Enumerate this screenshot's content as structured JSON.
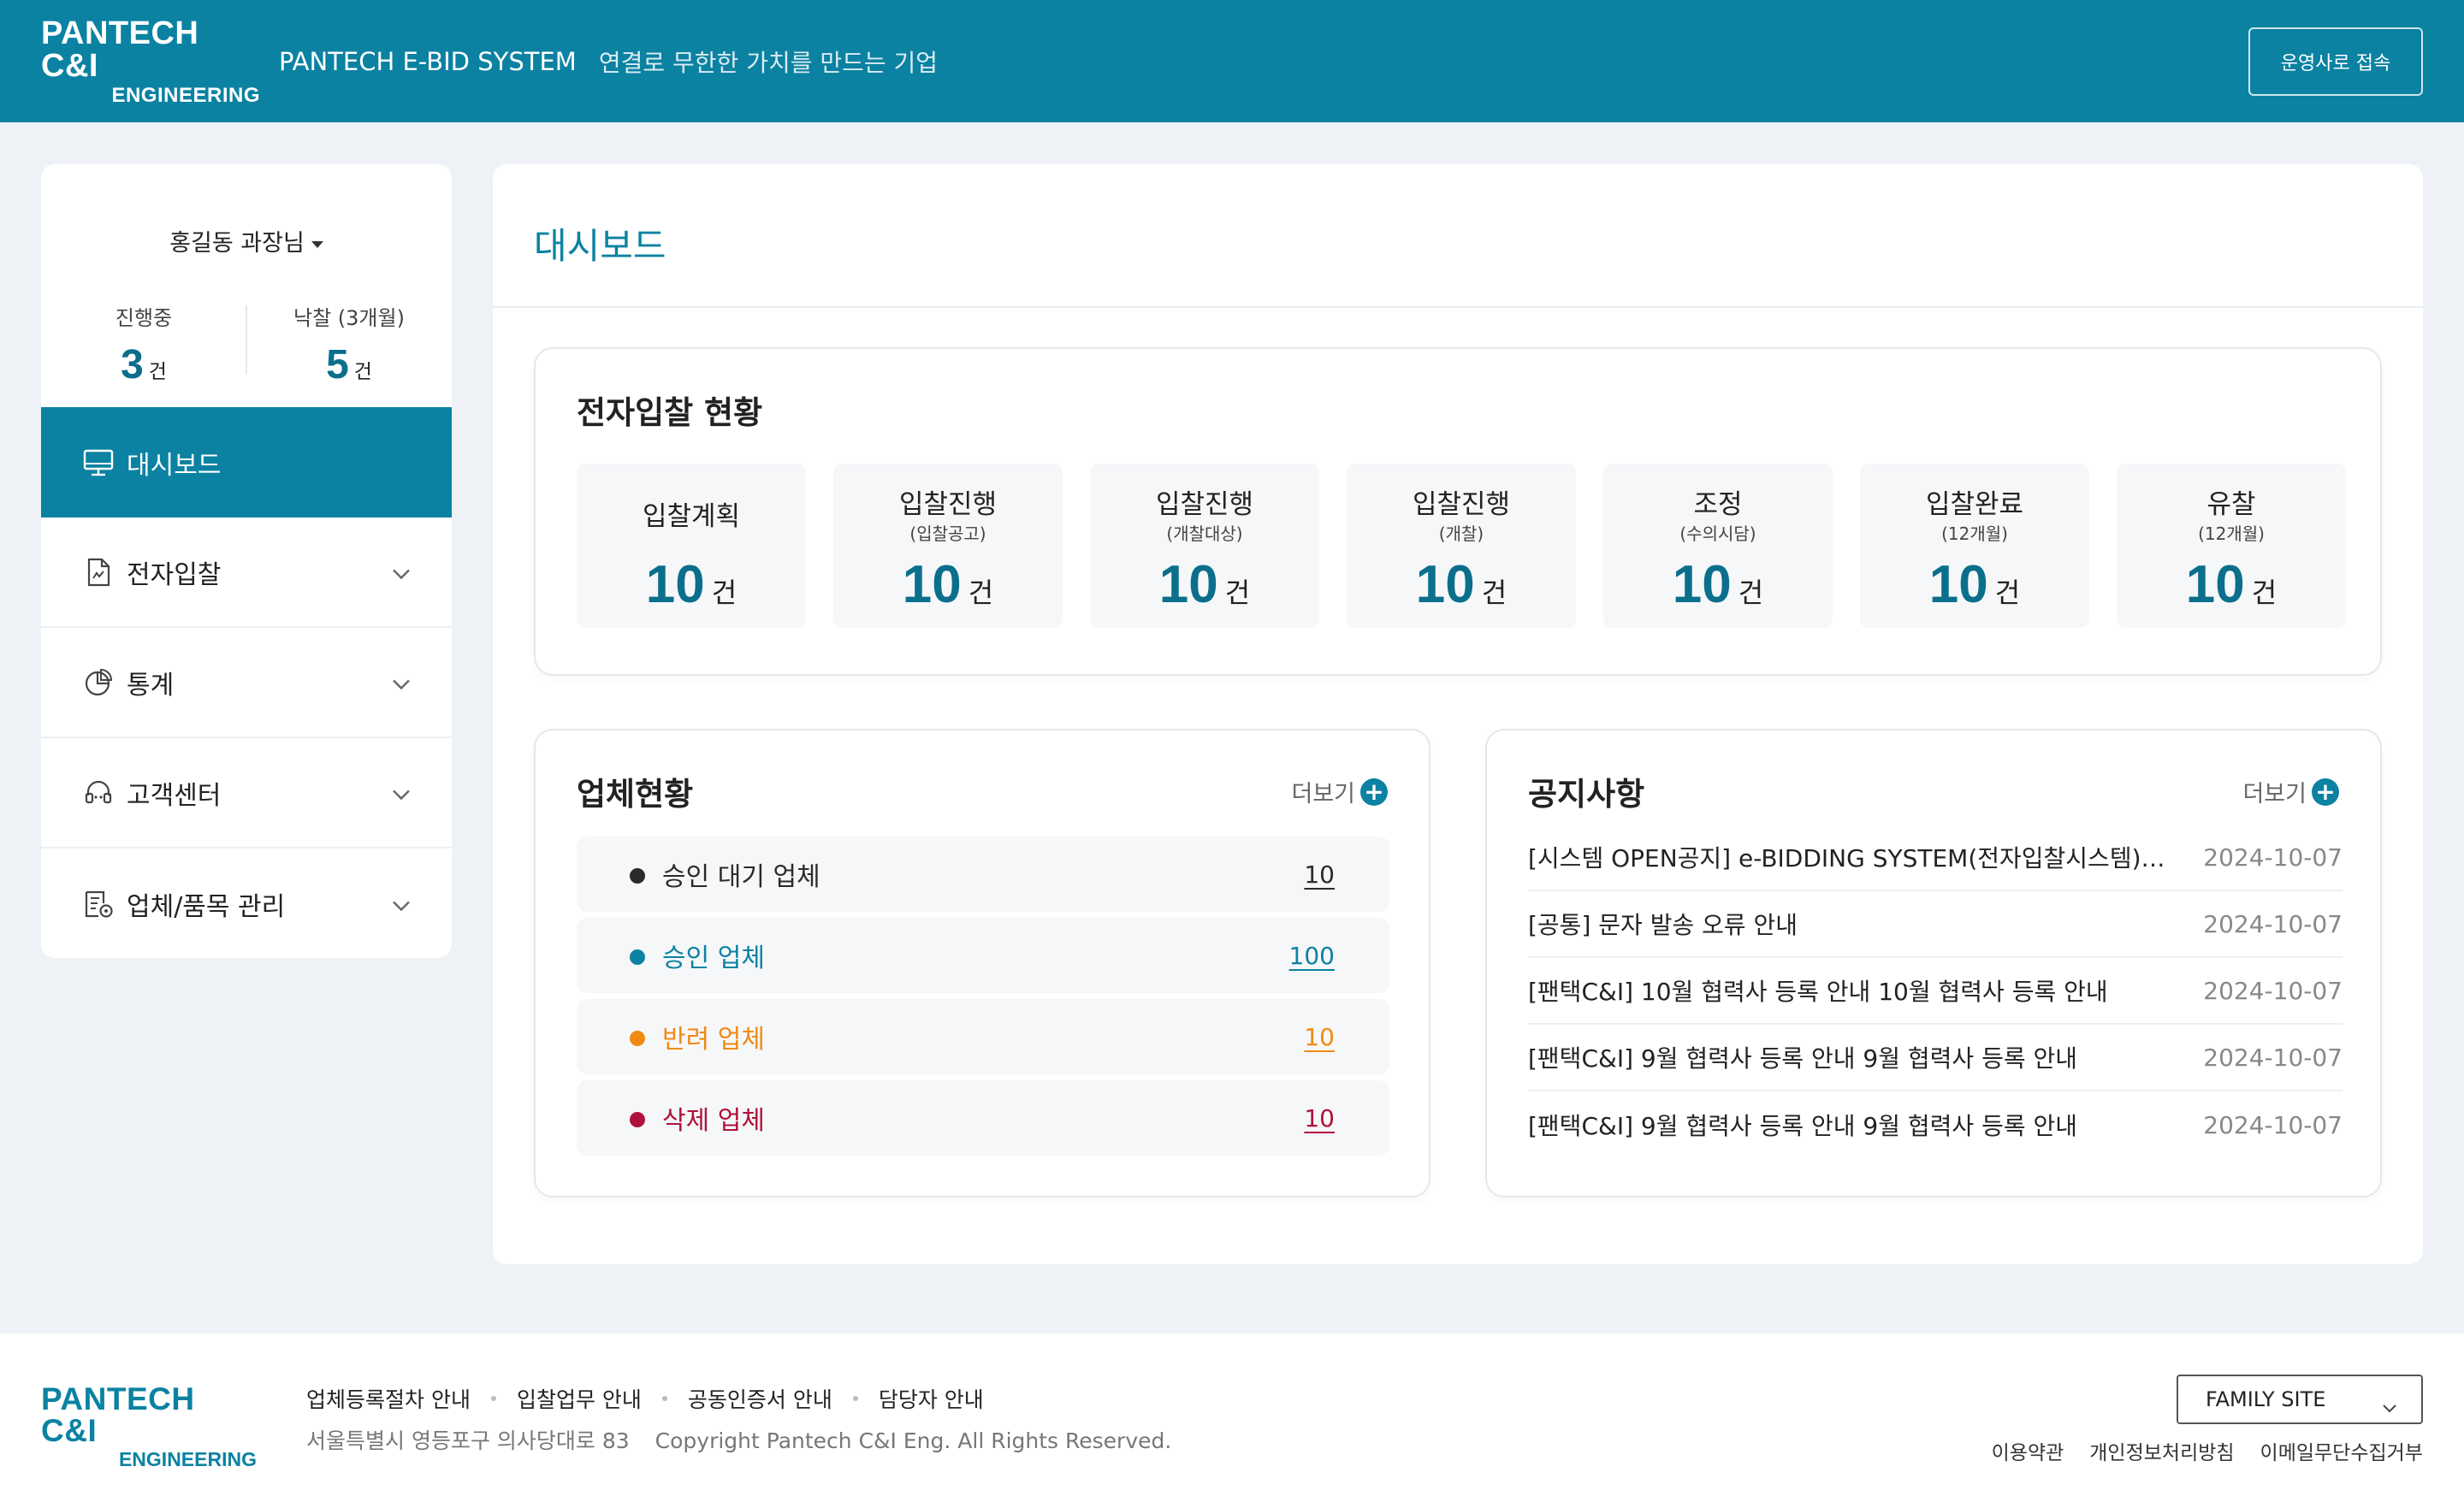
{
  "header": {
    "logo_line1": "PANTECH C&I",
    "logo_line2": "ENGINEERING",
    "system_name": "PANTECH E-BID SYSTEM",
    "slogan": "연결로 무한한 가치를 만드는 기업",
    "ops_button": "운영사로 접속"
  },
  "sidebar": {
    "user_name": "홍길동 과장님",
    "stats": [
      {
        "label": "진행중",
        "value": "3",
        "unit": "건"
      },
      {
        "label": "낙찰 (3개월)",
        "value": "5",
        "unit": "건"
      }
    ],
    "menu": [
      {
        "label": "대시보드",
        "icon": "monitor-icon",
        "active": true
      },
      {
        "label": "전자입찰",
        "icon": "document-icon"
      },
      {
        "label": "통계",
        "icon": "pie-chart-icon"
      },
      {
        "label": "고객센터",
        "icon": "headset-icon"
      },
      {
        "label": "업체/품목 관리",
        "icon": "list-settings-icon"
      }
    ]
  },
  "main": {
    "page_title": "대시보드",
    "bid_status": {
      "title": "전자입찰 현황",
      "tiles": [
        {
          "name": "입찰계획",
          "sub": "",
          "value": "10",
          "unit": "건"
        },
        {
          "name": "입찰진행",
          "sub": "(입찰공고)",
          "value": "10",
          "unit": "건"
        },
        {
          "name": "입찰진행",
          "sub": "(개찰대상)",
          "value": "10",
          "unit": "건"
        },
        {
          "name": "입찰진행",
          "sub": "(개찰)",
          "value": "10",
          "unit": "건"
        },
        {
          "name": "조정",
          "sub": "(수의시담)",
          "value": "10",
          "unit": "건"
        },
        {
          "name": "입찰완료",
          "sub": "(12개월)",
          "value": "10",
          "unit": "건"
        },
        {
          "name": "유찰",
          "sub": "(12개월)",
          "value": "10",
          "unit": "건"
        }
      ]
    },
    "company_status": {
      "title": "업체현황",
      "more": "더보기",
      "rows": [
        {
          "name": "승인 대기 업체",
          "count": "10",
          "color": "#2b2b2b"
        },
        {
          "name": "승인 업체",
          "count": "100",
          "color": "#0b82a2"
        },
        {
          "name": "반려 업체",
          "count": "10",
          "color": "#f08a12"
        },
        {
          "name": "삭제 업체",
          "count": "10",
          "color": "#b0123a"
        }
      ]
    },
    "notices": {
      "title": "공지사항",
      "more": "더보기",
      "rows": [
        {
          "title": "[시스템 OPEN공지] e-BIDDING SYSTEM(전자입찰시스템)이 ...",
          "date": "2024-10-07"
        },
        {
          "title": "[공통] 문자 발송 오류 안내",
          "date": "2024-10-07"
        },
        {
          "title": "[팬택C&I] 10월 협력사 등록 안내 10월 협력사 등록 안내",
          "date": "2024-10-07"
        },
        {
          "title": "[팬택C&I] 9월 협력사 등록 안내 9월 협력사 등록 안내",
          "date": "2024-10-07"
        },
        {
          "title": "[팬택C&I] 9월 협력사 등록 안내 9월 협력사 등록 안내",
          "date": "2024-10-07"
        }
      ]
    }
  },
  "footer": {
    "logo_line1": "PANTECH C&I",
    "logo_line2": "ENGINEERING",
    "links": [
      "업체등록절차 안내",
      "입찰업무 안내",
      "공동인증서 안내",
      "담당자 안내"
    ],
    "address": "서울특별시 영등포구 의사당대로 83",
    "copyright": "Copyright Pantech C&I Eng. All Rights Reserved.",
    "family_site": "FAMILY SITE",
    "policies": [
      "이용약관",
      "개인정보처리방침",
      "이메일무단수집거부"
    ]
  }
}
